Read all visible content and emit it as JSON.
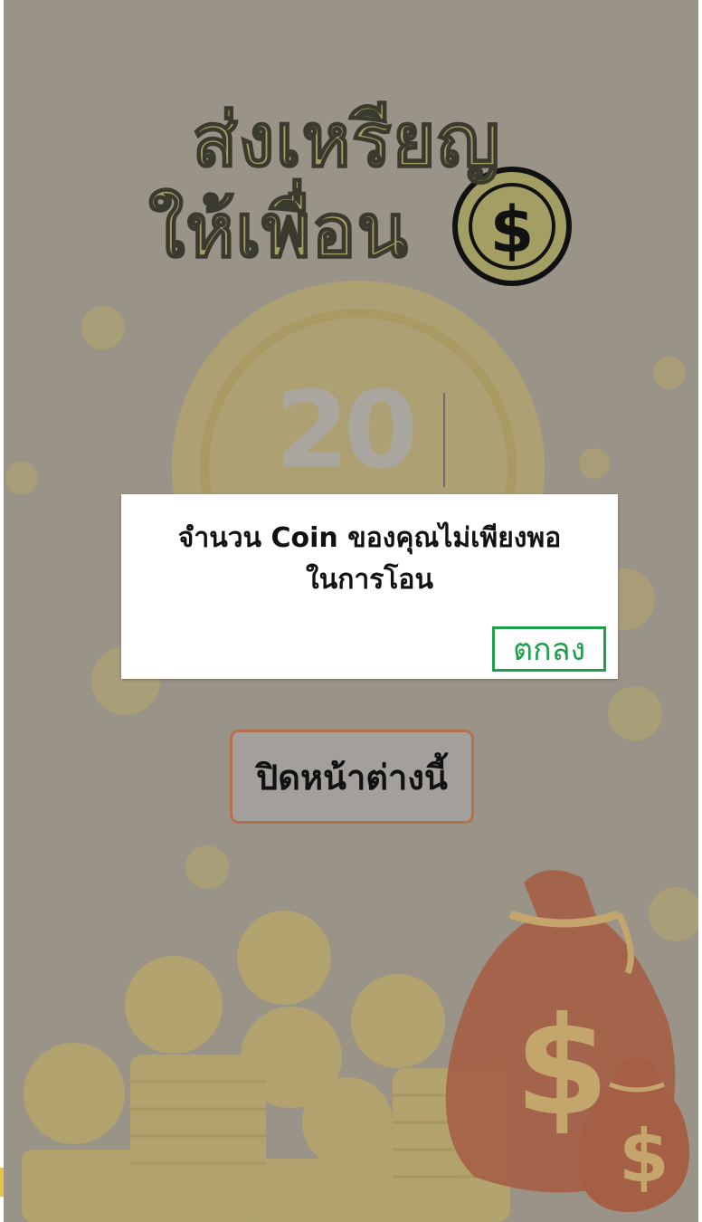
{
  "screen": {
    "title_line1": "ส่งเหรียญ",
    "title_line2": "ให้เพื่อน",
    "title_icon": "dollar-coin-icon",
    "amount": "20",
    "close_button_label": "ปิดหน้าต่างนี้"
  },
  "dialog": {
    "message_line1": "จำนวน Coin ของคุณไม่เพียงพอ",
    "message_line2": "ในการโอน",
    "ok_label": "ตกลง"
  },
  "colors": {
    "background": "#9a9387",
    "coin": "#b5a66b",
    "bag": "#a55f45",
    "ok_button": "#1f9e4b",
    "close_button_border": "#b5714d"
  }
}
